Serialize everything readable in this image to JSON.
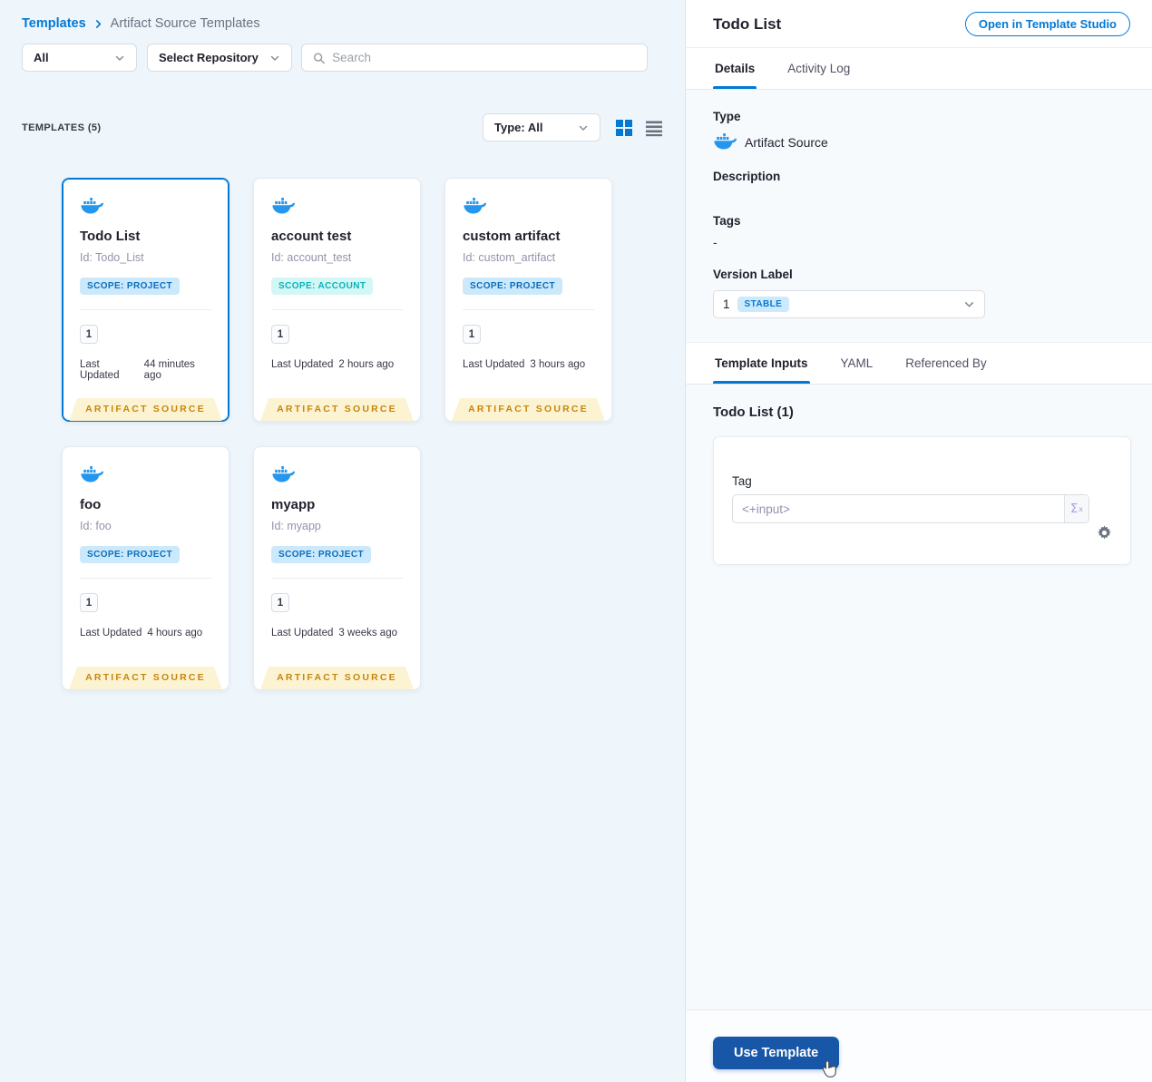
{
  "breadcrumb": {
    "root": "Templates",
    "current": "Artifact Source Templates"
  },
  "filters": {
    "scope_dropdown": "All",
    "repository_dropdown": "Select Repository",
    "search_placeholder": "Search"
  },
  "list_header": {
    "count_label": "TEMPLATES (5)",
    "type_filter": "Type: All"
  },
  "card_labels": {
    "last_updated": "Last Updated",
    "type_ribbon": "ARTIFACT SOURCE"
  },
  "cards": [
    {
      "name": "Todo List",
      "id": "Id: Todo_List",
      "scope": "SCOPE: PROJECT",
      "scope_type": "project",
      "version_count": "1",
      "last_updated": "44 minutes ago",
      "selected": true
    },
    {
      "name": "account test",
      "id": "Id: account_test",
      "scope": "SCOPE: ACCOUNT",
      "scope_type": "account",
      "version_count": "1",
      "last_updated": "2 hours ago",
      "selected": false
    },
    {
      "name": "custom artifact",
      "id": "Id: custom_artifact",
      "scope": "SCOPE: PROJECT",
      "scope_type": "project",
      "version_count": "1",
      "last_updated": "3 hours ago",
      "selected": false
    },
    {
      "name": "foo",
      "id": "Id: foo",
      "scope": "SCOPE: PROJECT",
      "scope_type": "project",
      "version_count": "1",
      "last_updated": "4 hours ago",
      "selected": false
    },
    {
      "name": "myapp",
      "id": "Id: myapp",
      "scope": "SCOPE: PROJECT",
      "scope_type": "project",
      "version_count": "1",
      "last_updated": "3 weeks ago",
      "selected": false
    }
  ],
  "panel": {
    "title": "Todo List",
    "open_studio_button": "Open in Template Studio",
    "tabs": {
      "details": "Details",
      "activity_log": "Activity Log"
    },
    "details": {
      "type_label": "Type",
      "type_value": "Artifact Source",
      "description_label": "Description",
      "tags_label": "Tags",
      "tags_value": "-",
      "version_label": "Version Label",
      "version_value": "1",
      "version_badge": "STABLE"
    },
    "inner_tabs": {
      "template_inputs": "Template Inputs",
      "yaml": "YAML",
      "referenced_by": "Referenced By"
    },
    "inputs": {
      "heading": "Todo List (1)",
      "tag_label": "Tag",
      "tag_value": "<+input>",
      "expression_button": "Σ"
    },
    "use_template_button": "Use Template"
  },
  "colors": {
    "accent": "#0278d5",
    "docker_blue": "#2496ed",
    "ribbon_bg": "#fcf3d3",
    "ribbon_text": "#c7860a",
    "primary_button": "#1857a8"
  }
}
